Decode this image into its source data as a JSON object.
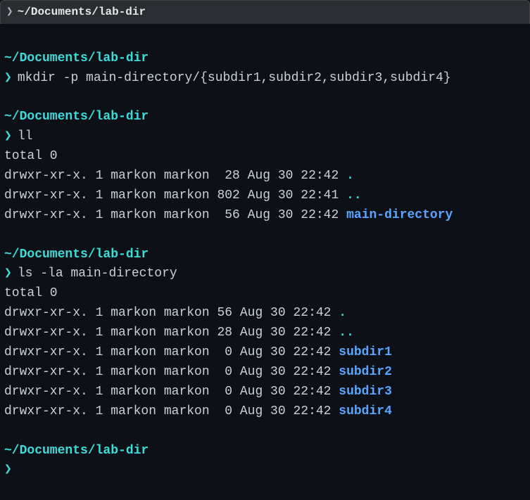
{
  "titlebar": {
    "prompt": "❯",
    "path": "~/Documents/lab-dir"
  },
  "blocks": [
    {
      "cwd": "~/Documents/lab-dir",
      "prompt": "❯",
      "cmd": "mkdir -p main-directory/{subdir1,subdir2,subdir3,subdir4}",
      "output": []
    },
    {
      "cwd": "~/Documents/lab-dir",
      "prompt": "❯",
      "cmd": "ll",
      "output": [
        {
          "pre": "total 0",
          "name": "",
          "cls": ""
        },
        {
          "pre": "drwxr-xr-x. 1 markon markon  28 Aug 30 22:42 ",
          "name": ".",
          "cls": "dot"
        },
        {
          "pre": "drwxr-xr-x. 1 markon markon 802 Aug 30 22:41 ",
          "name": "..",
          "cls": "dot"
        },
        {
          "pre": "drwxr-xr-x. 1 markon markon  56 Aug 30 22:42 ",
          "name": "main-directory",
          "cls": "dir-link"
        }
      ]
    },
    {
      "cwd": "~/Documents/lab-dir",
      "prompt": "❯",
      "cmd": "ls -la main-directory",
      "output": [
        {
          "pre": "total 0",
          "name": "",
          "cls": ""
        },
        {
          "pre": "drwxr-xr-x. 1 markon markon 56 Aug 30 22:42 ",
          "name": ".",
          "cls": "dot"
        },
        {
          "pre": "drwxr-xr-x. 1 markon markon 28 Aug 30 22:42 ",
          "name": "..",
          "cls": "dot"
        },
        {
          "pre": "drwxr-xr-x. 1 markon markon  0 Aug 30 22:42 ",
          "name": "subdir1",
          "cls": "dir-link"
        },
        {
          "pre": "drwxr-xr-x. 1 markon markon  0 Aug 30 22:42 ",
          "name": "subdir2",
          "cls": "dir-link"
        },
        {
          "pre": "drwxr-xr-x. 1 markon markon  0 Aug 30 22:42 ",
          "name": "subdir3",
          "cls": "dir-link"
        },
        {
          "pre": "drwxr-xr-x. 1 markon markon  0 Aug 30 22:42 ",
          "name": "subdir4",
          "cls": "dir-link"
        }
      ]
    },
    {
      "cwd": "~/Documents/lab-dir",
      "prompt": "❯",
      "cmd": "",
      "output": []
    }
  ]
}
